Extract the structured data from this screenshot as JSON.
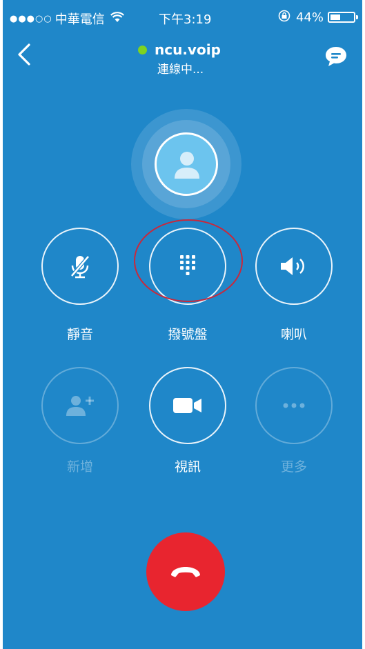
{
  "status_bar": {
    "signal": "●●●○○",
    "carrier": "中華電信",
    "time": "下午3:19",
    "battery_text": "44%",
    "battery_level": 0.44
  },
  "header": {
    "contact_name": "ncu.voip",
    "call_status": "連線中...",
    "presence_color": "#7ed321"
  },
  "controls": {
    "mute_label": "靜音",
    "dialpad_label": "撥號盤",
    "speaker_label": "喇叭",
    "add_label": "新增",
    "video_label": "視訊",
    "more_label": "更多"
  },
  "colors": {
    "background": "#1f87c9",
    "end_call": "#e8252f",
    "highlight_ring": "#c9283b"
  },
  "icons": [
    "back-chevron-icon",
    "chat-icon",
    "person-icon",
    "mic-off-icon",
    "dialpad-icon",
    "speaker-icon",
    "add-person-icon",
    "video-camera-icon",
    "ellipsis-icon",
    "phone-hangup-icon",
    "wifi-icon",
    "orientation-lock-icon",
    "battery-icon"
  ]
}
